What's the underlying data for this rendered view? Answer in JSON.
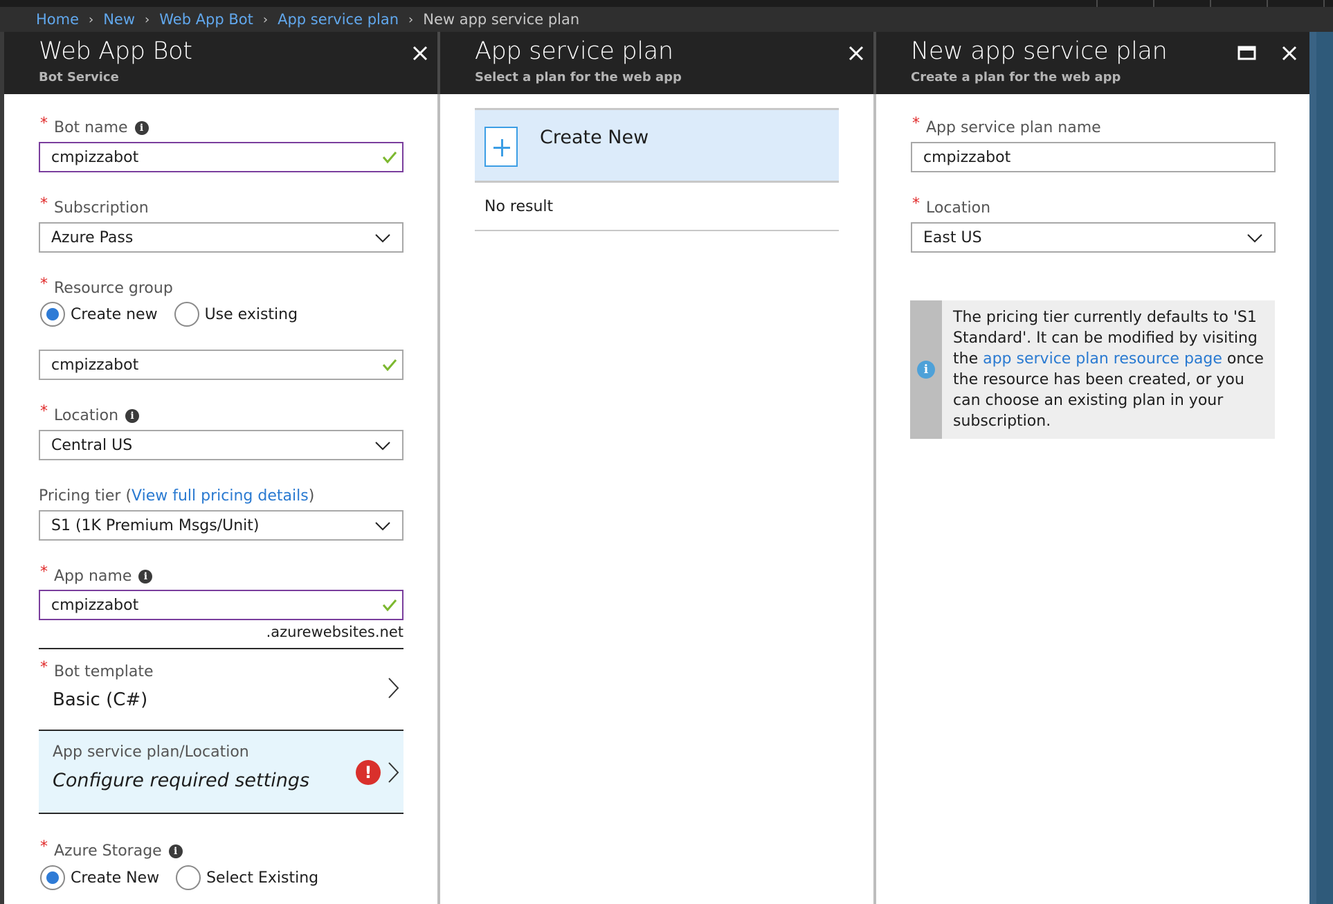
{
  "breadcrumb": [
    {
      "label": "Home",
      "link": true
    },
    {
      "label": "New",
      "link": true
    },
    {
      "label": "Web App Bot",
      "link": true
    },
    {
      "label": "App service plan",
      "link": true
    },
    {
      "label": "New app service plan",
      "link": false
    }
  ],
  "panel1": {
    "title": "Web App Bot",
    "subtitle": "Bot Service",
    "bot_name": {
      "label": "Bot name",
      "value": "cmpizzabot"
    },
    "subscription": {
      "label": "Subscription",
      "value": "Azure Pass"
    },
    "resource_group": {
      "label": "Resource group",
      "options": [
        "Create new",
        "Use existing"
      ],
      "selected": "Create new",
      "value": "cmpizzabot"
    },
    "location": {
      "label": "Location",
      "value": "Central US"
    },
    "pricing": {
      "label_prefix": "Pricing tier (",
      "link": "View full pricing details",
      "label_suffix": ")",
      "value": "S1 (1K Premium Msgs/Unit)"
    },
    "app_name": {
      "label": "App name",
      "value": "cmpizzabot",
      "suffix": ".azurewebsites.net"
    },
    "bot_template": {
      "label": "Bot template",
      "value": "Basic (C#)"
    },
    "app_service_plan": {
      "label": "App service plan/Location",
      "value": "Configure required settings",
      "status": "error"
    },
    "azure_storage": {
      "label": "Azure Storage",
      "options": [
        "Create New",
        "Select Existing"
      ],
      "selected": "Create New"
    }
  },
  "panel2": {
    "title": "App service plan",
    "subtitle": "Select a plan for the web app",
    "create_new_label": "Create New",
    "empty_text": "No result"
  },
  "panel3": {
    "title": "New app service plan",
    "subtitle": "Create a plan for the web app",
    "plan_name": {
      "label": "App service plan name",
      "value": "cmpizzabot"
    },
    "location": {
      "label": "Location",
      "value": "East US"
    },
    "info": {
      "text_before": "The pricing tier currently defaults to 'S1 Standard'. It can be modified by visiting the ",
      "link": "app service plan resource page",
      "text_after": " once the resource has been created, or you can choose an existing plan in your subscription."
    }
  },
  "colors": {
    "accent_link": "#2a7ad1",
    "breadcrumb_link": "#61a8ee",
    "required": "#e02b2b",
    "valid_check": "#7cb82f",
    "focus_border": "#7a3e9d",
    "error": "#d9302c",
    "selected_row": "#dcebfa"
  }
}
